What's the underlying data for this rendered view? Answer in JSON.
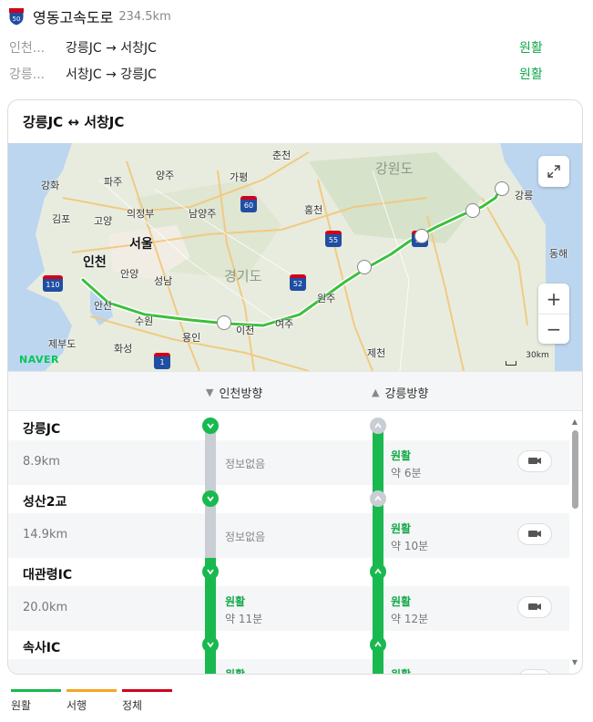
{
  "header": {
    "shield_number": "50",
    "name": "영동고속도로",
    "length": "234.5km"
  },
  "directions": [
    {
      "from": "인천...",
      "route": "강릉JC → 서창JC",
      "status": "원활"
    },
    {
      "from": "강릉...",
      "route": "서창JC → 강릉JC",
      "status": "원활"
    }
  ],
  "card": {
    "title": "강릉JC ↔ 서창JC",
    "map": {
      "labels": {
        "chuncheon": "춘천",
        "gangwondo": "강원도",
        "paju": "파주",
        "yangju": "양주",
        "gapyeong": "가평",
        "ganghwa": "강화",
        "uijeongbu": "의정부",
        "namyangju": "남양주",
        "hongcheon": "홍천",
        "gimpo": "김포",
        "goyang": "고양",
        "seoul": "서울",
        "incheon": "인천",
        "anyang": "안양",
        "seongnam": "성남",
        "gyeonggido": "경기도",
        "ansan": "안산",
        "suwon": "수원",
        "wonju": "원주",
        "yeoju": "여주",
        "icheon": "이천",
        "yongin": "용인",
        "hwaseong": "화성",
        "jebudo": "제부도",
        "jecheon": "제천",
        "gangneung": "강릉",
        "donghae": "동해"
      },
      "shields": [
        "60",
        "55",
        "52",
        "110",
        "1",
        "50"
      ],
      "logo": "NAVER",
      "scale": "30km",
      "zoom_in": "+",
      "zoom_out": "−"
    },
    "columns": {
      "incheon": "인천방향",
      "gangneung": "강릉방향"
    },
    "segments": [
      {
        "name": "강릉JC",
        "distance": "8.9km",
        "incheon": {
          "status": "정보없음"
        },
        "gangneung": {
          "status": "원활",
          "time": "약 6분"
        }
      },
      {
        "name": "성산2교",
        "distance": "14.9km",
        "incheon": {
          "status": "정보없음"
        },
        "gangneung": {
          "status": "원활",
          "time": "약 10분"
        }
      },
      {
        "name": "대관령IC",
        "distance": "20.0km",
        "incheon": {
          "status": "원활",
          "time": "약 11분"
        },
        "gangneung": {
          "status": "원활",
          "time": "약 12분"
        }
      },
      {
        "name": "속사IC",
        "distance": "",
        "incheon": {
          "status": "원활",
          "time": ""
        },
        "gangneung": {
          "status": "원활",
          "time": ""
        }
      }
    ]
  },
  "legend": [
    {
      "label": "원활",
      "color": "#19b94f"
    },
    {
      "label": "서행",
      "color": "#f5a623"
    },
    {
      "label": "정체",
      "color": "#d0021b"
    }
  ]
}
